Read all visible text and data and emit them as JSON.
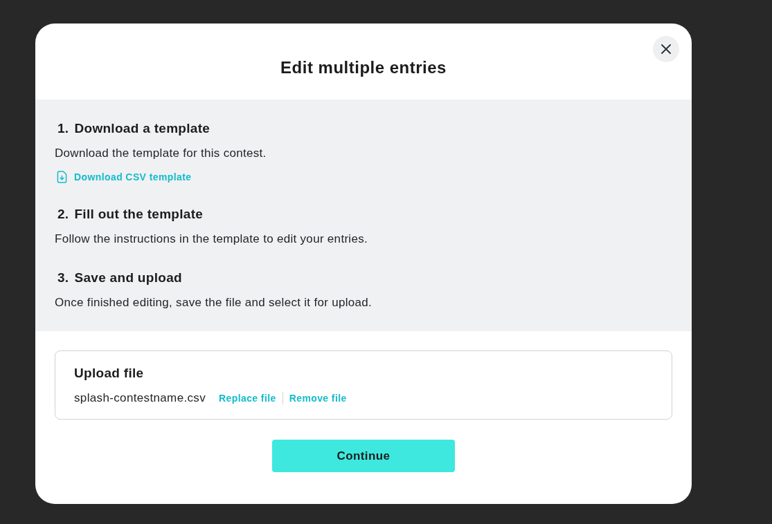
{
  "dialog": {
    "title": "Edit multiple entries"
  },
  "steps": [
    {
      "number": "1.",
      "title": "Download a template",
      "description": "Download the template for this contest.",
      "link": {
        "label": "Download CSV template"
      }
    },
    {
      "number": "2.",
      "title": "Fill out the template",
      "description": "Follow the instructions in the template to edit your entries."
    },
    {
      "number": "3.",
      "title": "Save and upload",
      "description": "Once finished editing, save the file and select it for upload."
    }
  ],
  "upload": {
    "title": "Upload file",
    "file_name": "splash-contestname.csv",
    "actions": [
      "Replace file",
      "Remove file"
    ]
  },
  "buttons": [
    "Continue"
  ]
}
